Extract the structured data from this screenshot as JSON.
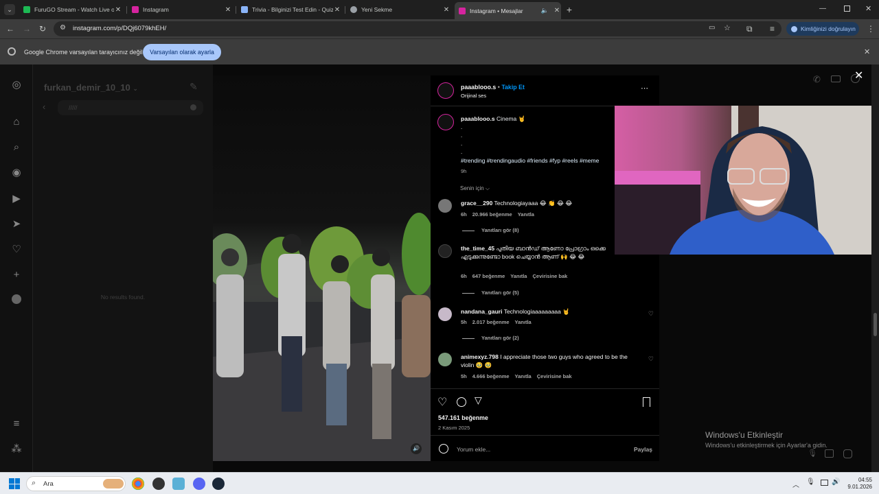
{
  "tabs": [
    {
      "title": "FuruGO Stream - Watch Live on",
      "favicon_color": "#1db954",
      "active": false
    },
    {
      "title": "Instagram",
      "favicon_color": "#d6249f",
      "active": false
    },
    {
      "title": "Trivia - Bilginizi Test Edin - Quiz",
      "favicon_color": "#8ab4f8",
      "active": false
    },
    {
      "title": "Yeni Sekme",
      "favicon_color": "#9aa0a6",
      "active": false
    },
    {
      "title": "Instagram • Mesajlar",
      "favicon_color": "#d6249f",
      "active": true
    }
  ],
  "address": {
    "url": "instagram.com/p/DQj6079khEH/"
  },
  "profile_button": {
    "label": "Kimliğinizi doğrulayın"
  },
  "infobar": {
    "text": "Google Chrome varsayılan tarayıcınız değil",
    "button": "Varsayılan olarak ayarla"
  },
  "dm": {
    "username": "furkan_demir_10_10",
    "search_value": "/////",
    "empty": "No results found."
  },
  "post": {
    "author": "paaablooo.s",
    "follow": "Takip Et",
    "audio": "Orijinal ses",
    "caption_user": "paaablooo.s",
    "caption_text": "Cinema 🤘",
    "dots": [
      ".",
      ".",
      ".",
      "."
    ],
    "hashtags": "#trending #trendingaudio #friends #fyp #reels #meme",
    "caption_time": "9h",
    "sort": "Senin için ⌵",
    "likes": "547.161 beğenme",
    "date": "2 Kasım 2025",
    "comment_placeholder": "Yorum ekle...",
    "post_button": "Paylaş"
  },
  "comments": [
    {
      "user": "grace__290",
      "text": "Technologiayaaa 😂 👏 😂 😂",
      "time": "6h",
      "likes": "20.966 beğenme",
      "reply": "Yanıtla",
      "translate": "",
      "view_replies": "Yanıtları gör (8)"
    },
    {
      "user": "the_time_45",
      "text": "പുതിയ ബാൻഡ് ആണോ പ്രോഗ്രാം ഒക്കെ എടുക്കുന്നുണ്ടോ book ചെയ്യാൻ ആണ് 🙌 😂 😂",
      "time": "6h",
      "likes": "647 beğenme",
      "reply": "Yanıtla",
      "translate": "Çevirisine bak",
      "view_replies": "Yanıtları gör (5)"
    },
    {
      "user": "nandana_gauri",
      "text": "Technologiaaaaaaaaa 🤘",
      "time": "5h",
      "likes": "2.017 beğenme",
      "reply": "Yanıtla",
      "translate": "",
      "view_replies": "Yanıtları gör (2)"
    },
    {
      "user": "animexyz.798",
      "text": "I appreciate those two guys who agreed to be the violin 🥹 🥹",
      "time": "5h",
      "likes": "4.666 beğenme",
      "reply": "Yanıtla",
      "translate": "Çevirisine bak",
      "view_replies": ""
    }
  ],
  "watermark": {
    "title": "Windows'u Etkinleştir",
    "subtitle": "Windows'u etkinleştirmek için Ayarlar'a gidin."
  },
  "taskbar": {
    "search": "Ara",
    "time": "04:55",
    "date": "9.01.2026"
  }
}
